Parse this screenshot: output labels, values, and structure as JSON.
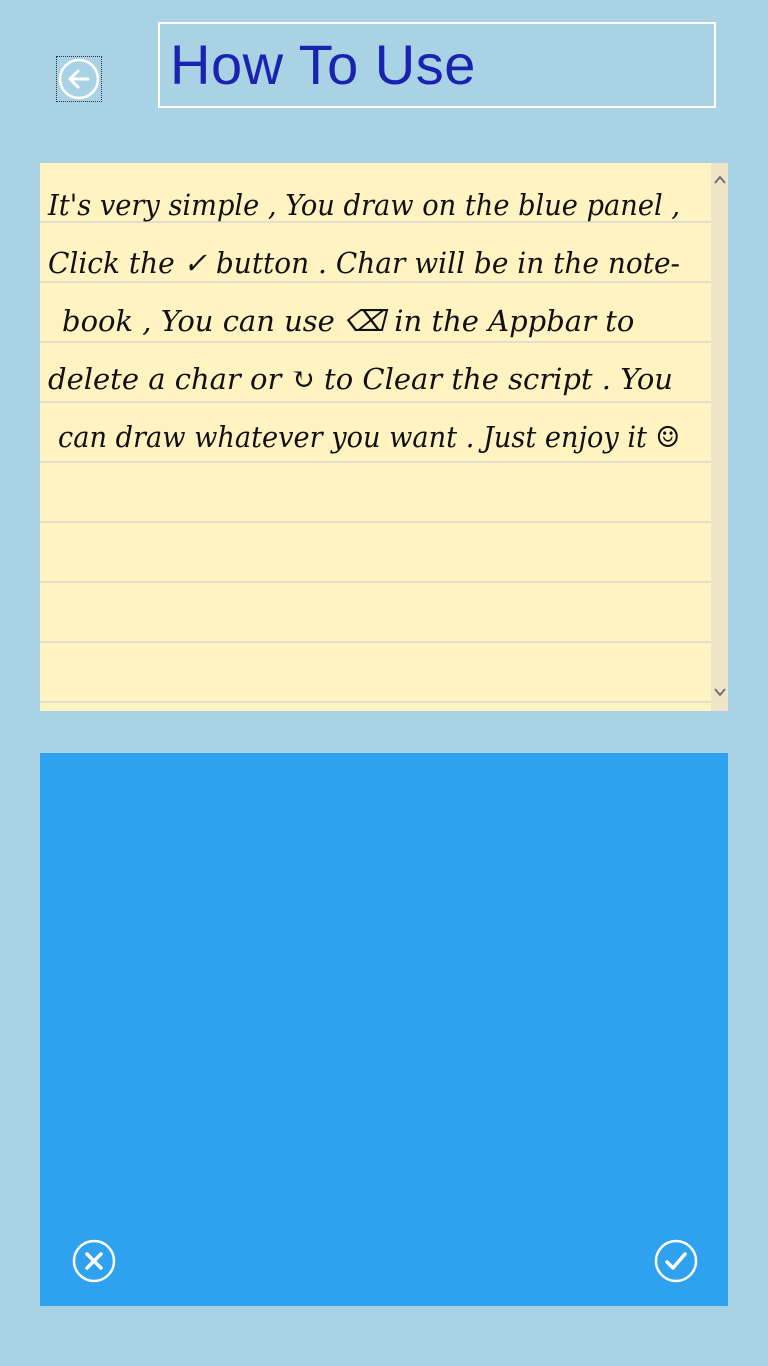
{
  "header": {
    "title": "How To Use",
    "back_icon": "back-arrow-icon"
  },
  "instructions": {
    "lines": [
      "It's very simple , You draw on the blue panel ,",
      "Click the ✓ button . Char will be in the note-",
      "book , You can use ⌫ in the Appbar to",
      "delete a char or ↻ to Clear the script . You",
      "can draw whatever you want . Just enjoy it ☺"
    ],
    "inline_icons": [
      "check-circle-icon",
      "backspace-circle-icon",
      "refresh-circle-icon",
      "bunny-smiley-icon"
    ]
  },
  "drawing_panel": {
    "clear_icon": "close-circle-icon",
    "confirm_icon": "check-circle-icon"
  },
  "colors": {
    "page_background": "#a9d2e4",
    "notebook_paper": "#fff3c2",
    "notebook_rule": "#d7d9d2",
    "drawing_panel": "#2ea1ef",
    "title_text": "#1a23b0"
  }
}
